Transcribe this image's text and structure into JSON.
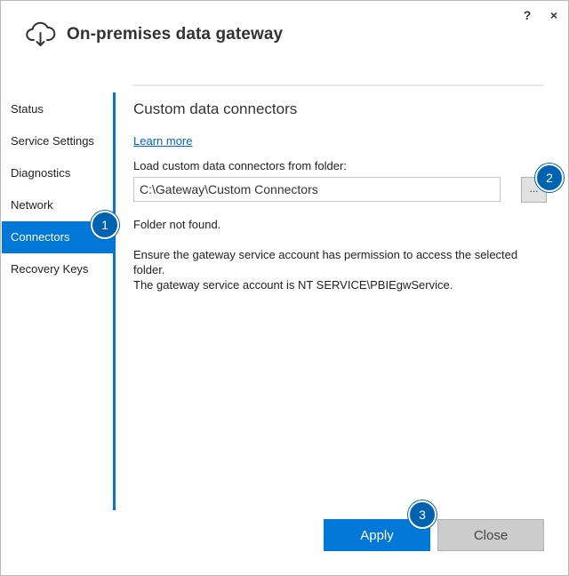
{
  "window": {
    "title": "On-premises data gateway",
    "help_label": "?",
    "close_label": "×"
  },
  "sidebar": {
    "items": [
      {
        "label": "Status"
      },
      {
        "label": "Service Settings"
      },
      {
        "label": "Diagnostics"
      },
      {
        "label": "Network"
      },
      {
        "label": "Connectors",
        "active": true
      },
      {
        "label": "Recovery Keys"
      }
    ]
  },
  "main": {
    "section_title": "Custom data connectors",
    "learn_more": "Learn more",
    "folder_label": "Load custom data connectors from folder:",
    "folder_value": "C:\\Gateway\\Custom Connectors",
    "browse_label": "...",
    "status": "Folder not found.",
    "info_line1": "Ensure the gateway service account has permission to access the selected folder.",
    "info_line2": "The gateway service account is NT SERVICE\\PBIEgwService."
  },
  "footer": {
    "apply_label": "Apply",
    "close_label": "Close"
  },
  "badges": [
    "1",
    "2",
    "3"
  ],
  "colors": {
    "accent": "#0078d7",
    "badge": "#0063b1"
  }
}
